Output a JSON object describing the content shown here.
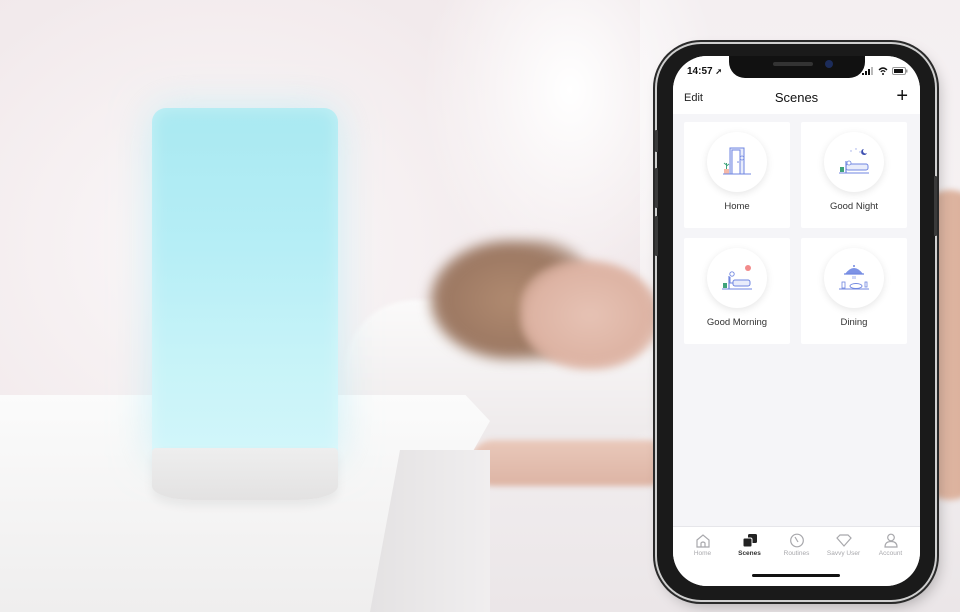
{
  "phone": {
    "status_bar": {
      "time": "14:57",
      "icons": [
        "location-arrow-icon",
        "signal-icon",
        "wifi-icon",
        "battery-icon"
      ]
    },
    "nav": {
      "edit_label": "Edit",
      "title": "Scenes",
      "add_label": "+"
    },
    "scenes": [
      {
        "label": "Home",
        "icon": "door-icon"
      },
      {
        "label": "Good Night",
        "icon": "bed-moon-icon"
      },
      {
        "label": "Good Morning",
        "icon": "bed-sun-icon"
      },
      {
        "label": "Dining",
        "icon": "cloche-icon"
      }
    ],
    "tabs": [
      {
        "label": "Home",
        "icon": "house-icon",
        "active": false
      },
      {
        "label": "Scenes",
        "icon": "scenes-icon",
        "active": true
      },
      {
        "label": "Routines",
        "icon": "clock-icon",
        "active": false
      },
      {
        "label": "Savvy User",
        "icon": "diamond-icon",
        "active": false
      },
      {
        "label": "Account",
        "icon": "person-icon",
        "active": false
      }
    ],
    "colors": {
      "illustration_accent": "#6f86e0",
      "plant_green": "#3fa37a",
      "sun_pink": "#f28b8b"
    }
  },
  "lamp": {
    "glow_color": "#b6eef6"
  }
}
